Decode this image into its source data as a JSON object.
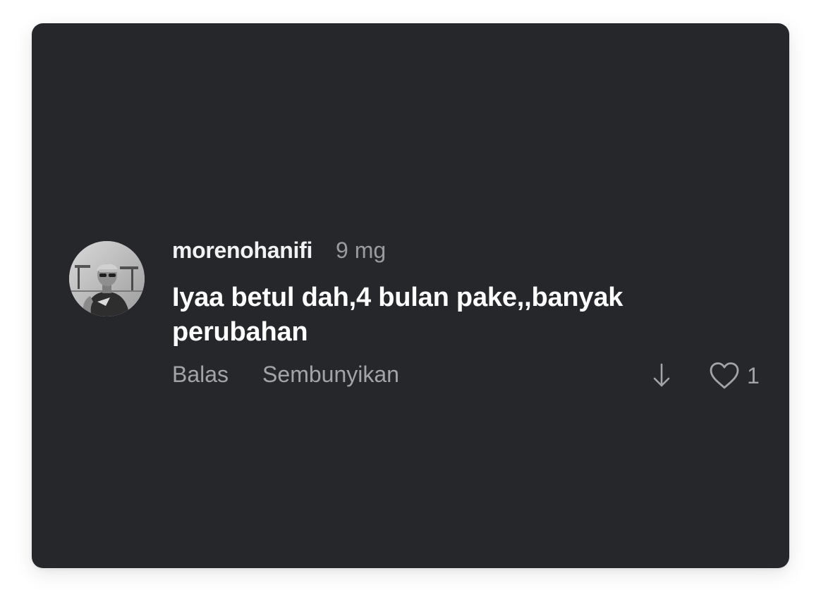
{
  "comment": {
    "username": "morenohanifi",
    "timestamp": "9 mg",
    "text": "Iyaa betul dah,4 bulan pake,,banyak perubahan",
    "reply_label": "Balas",
    "hide_label": "Sembunyikan",
    "like_count": "1",
    "icons": {
      "avatar": "profile-photo",
      "dislike": "arrow-down-icon",
      "like": "heart-outline-icon"
    }
  },
  "colors": {
    "card_background": "#25272b",
    "primary_text": "#ffffff",
    "secondary_text": "#a3a4a6"
  }
}
